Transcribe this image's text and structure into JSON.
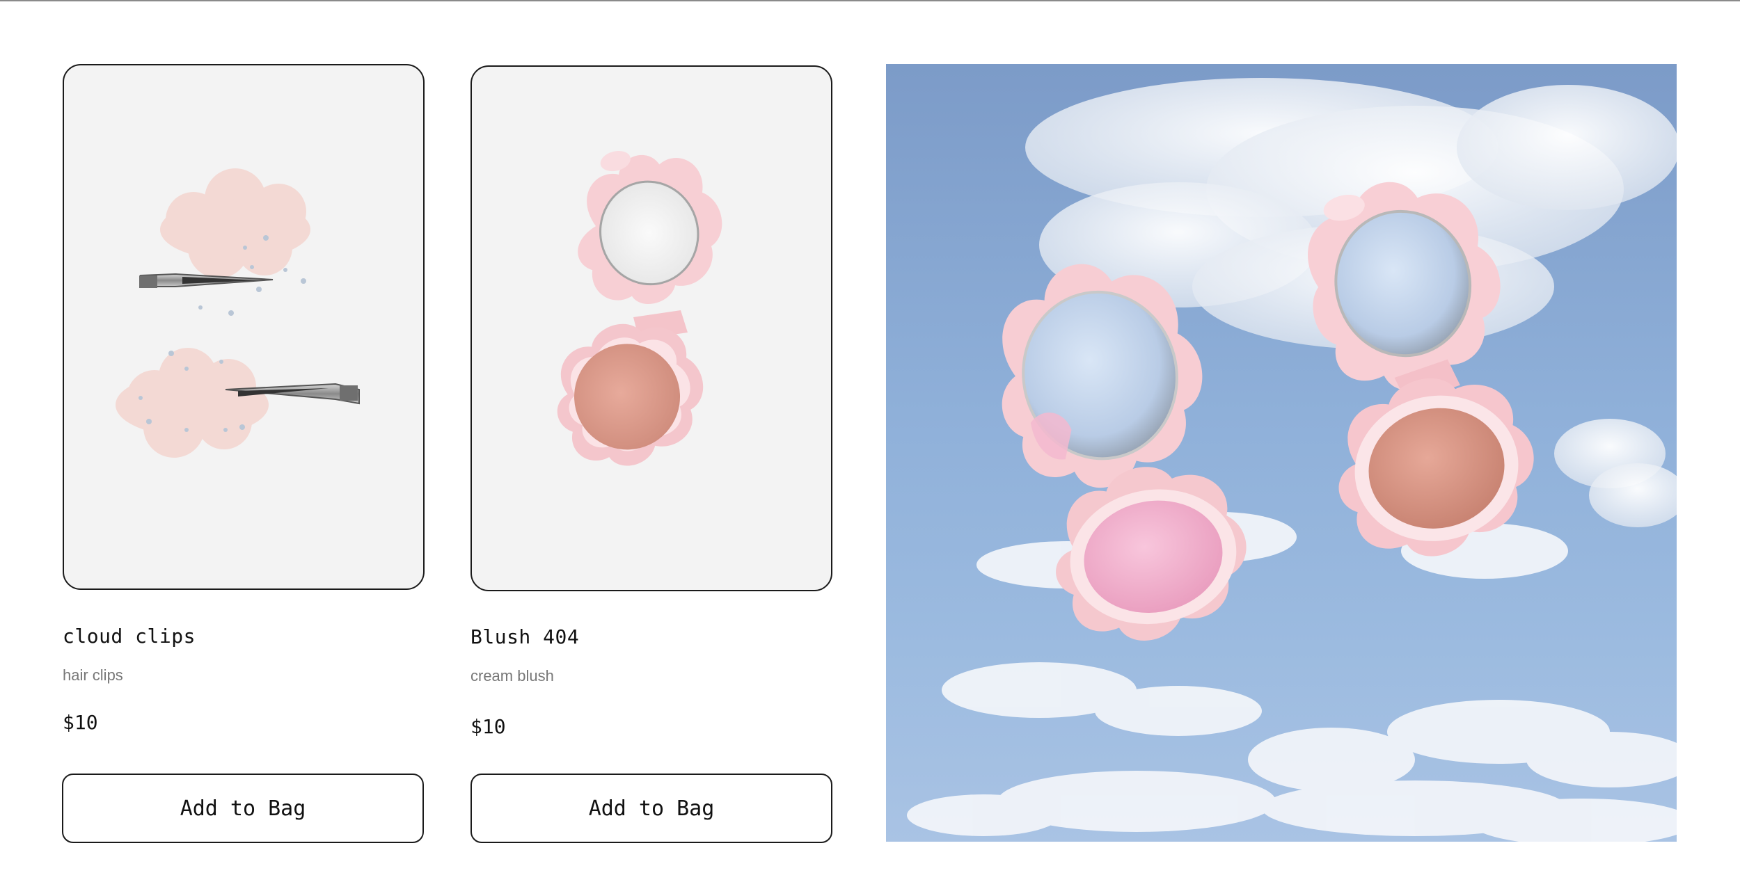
{
  "products": [
    {
      "name": "cloud clips",
      "subtitle": "hair clips",
      "price": "$10",
      "button_label": "Add to Bag",
      "image_icon": "cloud-hair-clips-image"
    },
    {
      "name": "Blush 404",
      "subtitle": "cream blush",
      "price": "$10",
      "button_label": "Add to Bag",
      "image_icon": "blush-compact-image"
    }
  ],
  "hero": {
    "image_icon": "blush-compacts-in-sky-image"
  },
  "colors": {
    "card_bg": "#f3f3f3",
    "border": "#1a1a1a",
    "blush_pink": "#f6c9cf",
    "blush_pan": "#dc9a8c",
    "sky": "#8fb0d9"
  }
}
